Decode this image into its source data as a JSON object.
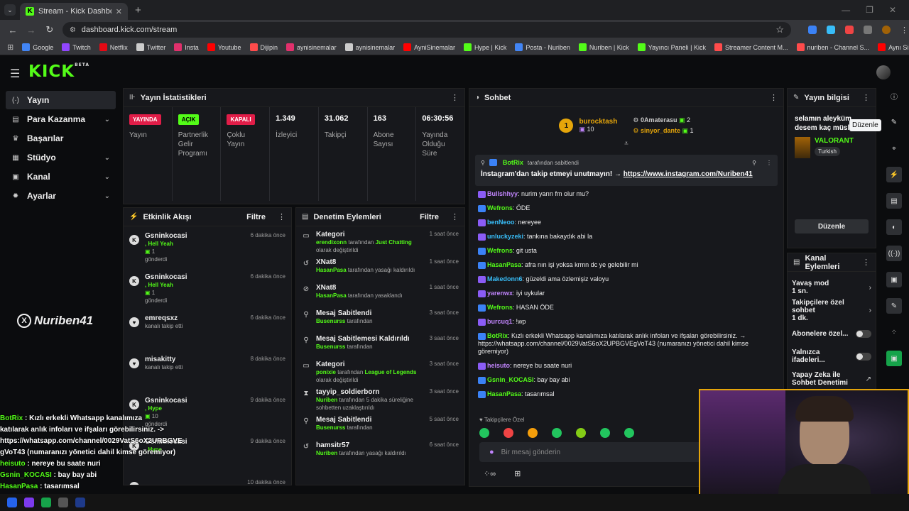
{
  "browser": {
    "tab_title": "Stream - Kick Dashboard",
    "url": "dashboard.kick.com/stream",
    "bookmarks": [
      {
        "label": "Google",
        "color": "#4285f4"
      },
      {
        "label": "Twitch",
        "color": "#9146ff"
      },
      {
        "label": "Netflix",
        "color": "#e50914"
      },
      {
        "label": "Twitter",
        "color": "#cccccc"
      },
      {
        "label": "Insta",
        "color": "#e1306c"
      },
      {
        "label": "Youtube",
        "color": "#ff0000"
      },
      {
        "label": "Dijipin",
        "color": "#ff4b4b"
      },
      {
        "label": "aynisinemalar",
        "color": "#e1306c"
      },
      {
        "label": "aynisinemalar",
        "color": "#cccccc"
      },
      {
        "label": "AyniSinemalar",
        "color": "#ff0000"
      },
      {
        "label": "Hype | Kick",
        "color": "#53fc18"
      },
      {
        "label": "Posta - Nuriben",
        "color": "#4285f4"
      },
      {
        "label": "Nuriben | Kick",
        "color": "#53fc18"
      },
      {
        "label": "Yayıncı Paneli | Kick",
        "color": "#53fc18"
      },
      {
        "label": "Streamer Content M...",
        "color": "#ff4b4b"
      },
      {
        "label": "nuriben - Channel S...",
        "color": "#ff4b4b"
      },
      {
        "label": "Aynı Sinemalar - Ça...",
        "color": "#ff0000"
      }
    ]
  },
  "app": {
    "logo": "KICK",
    "logo_sup": "BETA"
  },
  "sidebar": [
    {
      "label": "Yayın",
      "icon": "(·)",
      "chevron": ""
    },
    {
      "label": "Para Kazanma",
      "icon": "▤",
      "chevron": "⌄"
    },
    {
      "label": "Başarılar",
      "icon": "♛",
      "chevron": ""
    },
    {
      "label": "Stüdyo",
      "icon": "▦",
      "chevron": "⌄"
    },
    {
      "label": "Kanal",
      "icon": "▣",
      "chevron": "⌄"
    },
    {
      "label": "Ayarlar",
      "icon": "✹",
      "chevron": "⌄"
    }
  ],
  "watermark": "Nuriben41",
  "stats": {
    "title": "Yayın İstatistikleri",
    "items": [
      {
        "badge": "YAYINDA",
        "value": "",
        "label": "Yayın"
      },
      {
        "badge": "AÇIK",
        "value": "",
        "label": "Partnerlik Gelir Programı"
      },
      {
        "badge": "KAPALI",
        "value": "",
        "label": "Çoklu Yayın"
      },
      {
        "badge": "",
        "value": "1.349",
        "label": "İzleyici"
      },
      {
        "badge": "",
        "value": "31.062",
        "label": "Takipçi"
      },
      {
        "badge": "",
        "value": "163",
        "label": "Abone Sayısı"
      },
      {
        "badge": "",
        "value": "06:30:56",
        "label": "Yayında Olduğu Süre"
      }
    ]
  },
  "activity": {
    "title": "Etkinlik Akışı",
    "filter": "Filtre",
    "items": [
      {
        "icon": "K",
        "name": "Gsninkocasi",
        "detail": ", Hell Yeah",
        "count": "1",
        "sub": "gönderdi",
        "time": "6 dakika önce"
      },
      {
        "icon": "K",
        "name": "Gsninkocasi",
        "detail": ", Hell Yeah",
        "count": "1",
        "sub": "gönderdi",
        "time": "6 dakika önce"
      },
      {
        "icon": "♥",
        "name": "emreqsxz",
        "detail": "",
        "count": "",
        "sub": "kanalı takip etti",
        "time": "6 dakika önce"
      },
      {
        "icon": "♥",
        "name": "misakitty",
        "detail": "",
        "count": "",
        "sub": "kanalı takip etti",
        "time": "8 dakika önce"
      },
      {
        "icon": "K",
        "name": "Gsninkocasi",
        "detail": ", Hype",
        "count": "10",
        "sub": "gönderdi",
        "time": "9 dakika önce"
      },
      {
        "icon": "K",
        "name": "Gsninkocasi",
        "detail": ", Hype",
        "count": "",
        "sub": "",
        "time": "9 dakika önce"
      },
      {
        "icon": "K",
        "name": "",
        "detail": "",
        "count": "",
        "sub": "",
        "time": "10 dakika önce"
      }
    ]
  },
  "mod": {
    "title": "Denetim Eylemleri",
    "filter": "Filtre",
    "items": [
      {
        "icon": "▭",
        "title": "Kategori",
        "user": "erendixonn",
        "mid": " tarafından ",
        "hl": "Just Chatting",
        "tail": " olarak değiştirildi",
        "time": "1 saat önce"
      },
      {
        "icon": "↺",
        "title": "XNat8",
        "user": "HasanPasa",
        "mid": "",
        "hl": "",
        "tail": " tarafından yasağı kaldırıldı",
        "time": "1 saat önce"
      },
      {
        "icon": "⊘",
        "title": "XNat8",
        "user": "HasanPasa",
        "mid": "",
        "hl": "",
        "tail": " tarafından yasaklandı",
        "time": "1 saat önce"
      },
      {
        "icon": "⚲",
        "title": "Mesaj Sabitlendi",
        "user": "Busenurss",
        "mid": "",
        "hl": "",
        "tail": " tarafından",
        "time": "3 saat önce"
      },
      {
        "icon": "⚲",
        "title": "Mesaj Sabitlemesi Kaldırıldı",
        "user": "Busenurss",
        "mid": "",
        "hl": "",
        "tail": " tarafından",
        "time": "3 saat önce"
      },
      {
        "icon": "▭",
        "title": "Kategori",
        "user": "ponixie",
        "mid": " tarafından ",
        "hl": "League of Legends",
        "tail": " olarak değiştirildi",
        "time": "3 saat önce"
      },
      {
        "icon": "⧗",
        "title": "tayyip_soldierborn",
        "user": "Nuriben",
        "mid": "",
        "hl": "",
        "tail": " tarafından 5 dakika süreliğine sohbetten uzaklaştırıldı",
        "time": "3 saat önce"
      },
      {
        "icon": "⚲",
        "title": "Mesaj Sabitlendi",
        "user": "Busenurss",
        "mid": "",
        "hl": "",
        "tail": " tarafından",
        "time": "5 saat önce"
      },
      {
        "icon": "↺",
        "title": "hamsitr57",
        "user": "Nuriben",
        "mid": "",
        "hl": "",
        "tail": " tarafından yasağı kaldırıldı",
        "time": "6 saat önce"
      }
    ]
  },
  "chat": {
    "title": "Sohbet",
    "top1": {
      "rank": "1",
      "name": "burocktash",
      "gift": "10"
    },
    "top2": {
      "name": "0Amaterasu",
      "gift": "2"
    },
    "top3": {
      "name": "sinyor_dante",
      "gift": "1"
    },
    "pinned": {
      "user": "BotRix",
      "by": "tarafından sabitlendi",
      "text": "İnstagram'dan takip etmeyi unutmayın! → ",
      "link": "https://www.instagram.com/Nuriben41"
    },
    "messages": [
      {
        "user": "Bullshhyy",
        "color": "#c084fc",
        "text": ": nurim yarın fm olur mu?"
      },
      {
        "user": "Wefrons",
        "color": "#53fc18",
        "text": ": ÖDE"
      },
      {
        "user": "benNeoo",
        "color": "#38bdf8",
        "text": ": nereyee"
      },
      {
        "user": "unluckyzeki",
        "color": "#38bdf8",
        "text": ": tankına bakaydık abi la"
      },
      {
        "user": "Wefrons",
        "color": "#53fc18",
        "text": ": git usta"
      },
      {
        "user": "HasanPasa",
        "color": "#53fc18",
        "text": ": afra nın işi yoksa krmn dc ye gelebilir mi"
      },
      {
        "user": "Makedonn6",
        "color": "#38bdf8",
        "text": ": güzeldi ama özlemişiz valoyu"
      },
      {
        "user": "yarenwx",
        "color": "#c084fc",
        "text": ": iyi uykular"
      },
      {
        "user": "Wefrons",
        "color": "#53fc18",
        "text": ": HASAN ÖDE"
      },
      {
        "user": "burcuq1",
        "color": "#c084fc",
        "text": ": !wp"
      },
      {
        "user": "BotRix",
        "color": "#53fc18",
        "text": ": Kızlı erkekli Whatsapp kanalımıza katılarak anlık infoları ve ifşaları görebilirsiniz. → https://whatsapp.com/channel/0029VatS6oX2UPBGVEgVoT43 (numaranızı yönetici dahil kimse göremiyor)"
      },
      {
        "user": "heisuto",
        "color": "#c084fc",
        "text": ": nereye bu saate nuri"
      },
      {
        "user": "Gsnin_KOCASI",
        "color": "#53fc18",
        "text": ": bay bay abi"
      },
      {
        "user": "HasanPasa",
        "color": "#53fc18",
        "text": ": tasarımsal"
      }
    ],
    "emote_label": "Takipçilere Özel",
    "placeholder": "Bir mesaj gönderin"
  },
  "info": {
    "title": "Yayın bilgisi",
    "stream_title": "selamın aleyküm desem kaç müsli",
    "tooltip": "Düzenle",
    "game": "VALORANT",
    "lang": "Turkish",
    "edit": "Düzenle"
  },
  "actions": {
    "title": "Kanal Eylemleri",
    "items": [
      {
        "label": "Yavaş mod",
        "value": "1 sn.",
        "type": "chevron"
      },
      {
        "label": "Takipçilere özel sohbet",
        "value": "1 dk.",
        "type": "chevron"
      },
      {
        "label": "Abonelere özel...",
        "value": "",
        "type": "toggle"
      },
      {
        "label": "Yalnızca ifadeleri...",
        "value": "",
        "type": "toggle"
      },
      {
        "label": "Yapay Zeka ile Sohbet Denetimi",
        "value": "",
        "type": "ext"
      }
    ]
  },
  "overlay": [
    {
      "user": "BotRix",
      "text": " : Kızlı erkekli Whatsapp kanalımıza"
    },
    {
      "user": "",
      "text": "katılarak anlık infoları ve ifşaları görebilirsiniz. ->"
    },
    {
      "user": "",
      "text": "https://whatsapp.com/channel/0029VatS6oX2URBGVE"
    },
    {
      "user": "",
      "text": "gVoT43 (numaranızı yönetici dahil kimse göremiyor)"
    },
    {
      "user": "heisuto",
      "text": " : nereye bu saate nuri"
    },
    {
      "user": "Gsnin_KOCASI",
      "text": " : bay bay abi"
    },
    {
      "user": "HasanPasa",
      "text": " : tasarımsal"
    }
  ]
}
